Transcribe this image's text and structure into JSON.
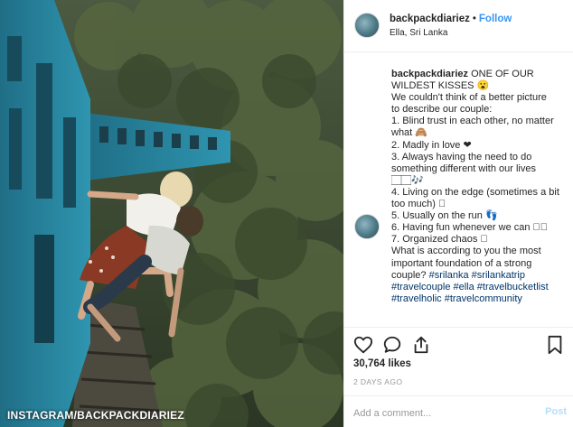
{
  "post": {
    "username": "backpackdiariez",
    "separator": "•",
    "follow_label": "Follow",
    "location": "Ella, Sri Lanka"
  },
  "caption": {
    "username": "backpackdiariez",
    "lines": [
      "ONE OF OUR",
      "WILDEST KISSES 😮",
      "We couldn't think of a better picture",
      "to describe our couple:",
      "1. Blind trust in each other, no matter",
      "what 🙈",
      "2. Madly in love ❤",
      "3. Always having the need to do",
      "something different with our lives",
      "🏻🏻🎶",
      "4. Living on the edge (sometimes a bit",
      "too much) 🏻",
      "5. Usually on the run 👣",
      "6. Having fun whenever we can 🏻🏻",
      "7. Organized chaos 🏻",
      "What is according to you the most",
      "important foundation of a strong",
      "couple?"
    ],
    "hashtags": [
      "#srilanka #srilankatrip",
      "#travelcouple #ella #travelbucketlist",
      "#travelholic #travelcommunity"
    ]
  },
  "actions": {
    "like_icon": "heart-icon",
    "comment_icon": "comment-icon",
    "share_icon": "share-icon",
    "save_icon": "bookmark-icon",
    "likes": "30,764 likes",
    "time_ago": "2 DAYS AGO",
    "comment_placeholder": "Add a comment...",
    "post_label": "Post"
  },
  "photo": {
    "watermark": "INSTAGRAM/BACKPACKDIARIEZ"
  }
}
